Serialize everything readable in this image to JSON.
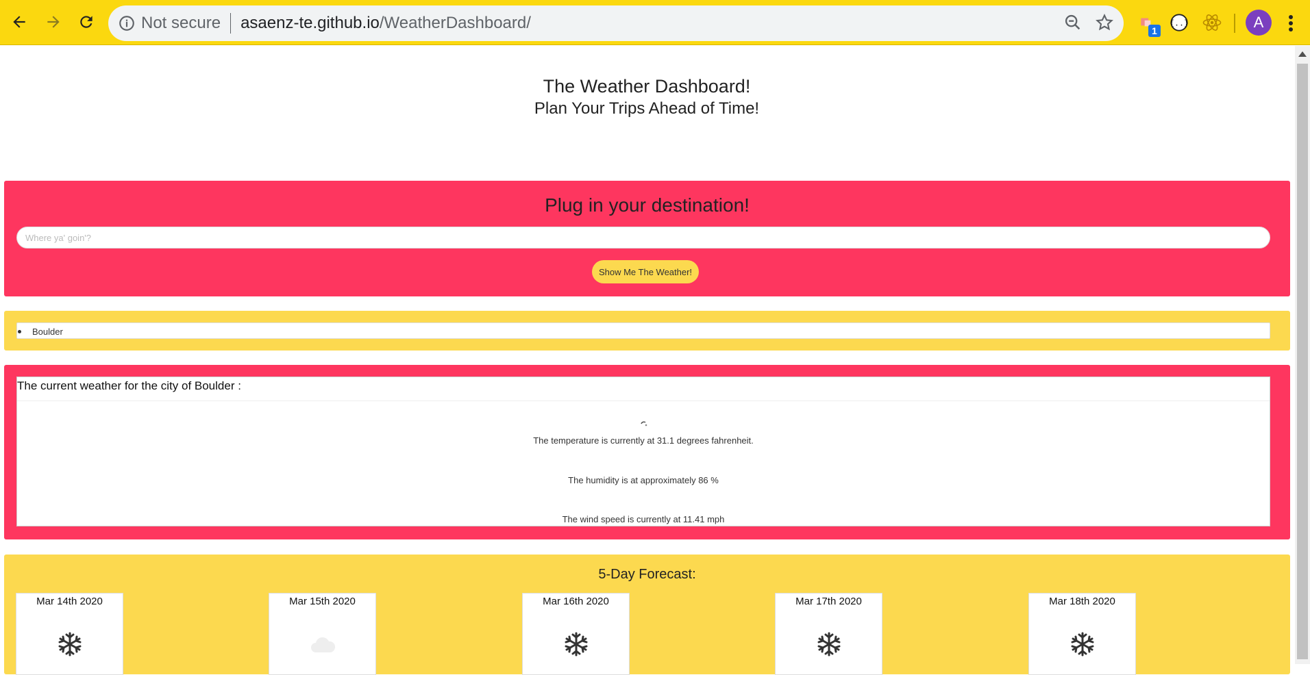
{
  "browser": {
    "security_label": "Not secure",
    "url_host": "asaenz-te.github.io",
    "url_path": "/WeatherDashboard/",
    "extension_badge": "1",
    "avatar_letter": "A"
  },
  "header": {
    "title": "The Weather Dashboard!",
    "subtitle": "Plan Your Trips Ahead of Time!"
  },
  "search": {
    "title": "Plug in your destination!",
    "placeholder": "Where ya' goin'?",
    "value": "",
    "button_label": "Show Me The Weather!"
  },
  "history": {
    "items": [
      "Boulder"
    ]
  },
  "current": {
    "heading": "The current weather for the city of Boulder :",
    "icon": "loading-icon",
    "temperature": "The temperature is currently at 31.1 degrees fahrenheit.",
    "humidity": "The humidity is at approximately 86 %",
    "wind": "The wind speed is currently at 11.41 mph"
  },
  "forecast": {
    "title": "5-Day Forecast:",
    "days": [
      {
        "date": "Mar 14th 2020",
        "icon": "snowflake-icon"
      },
      {
        "date": "Mar 15th 2020",
        "icon": "cloud-icon"
      },
      {
        "date": "Mar 16th 2020",
        "icon": "snowflake-icon"
      },
      {
        "date": "Mar 17th 2020",
        "icon": "snowflake-icon"
      },
      {
        "date": "Mar 18th 2020",
        "icon": "snowflake-icon"
      }
    ]
  },
  "colors": {
    "chrome": "#fbd80f",
    "pink_panel": "#fe365f",
    "yellow_panel": "#fcd94f"
  }
}
